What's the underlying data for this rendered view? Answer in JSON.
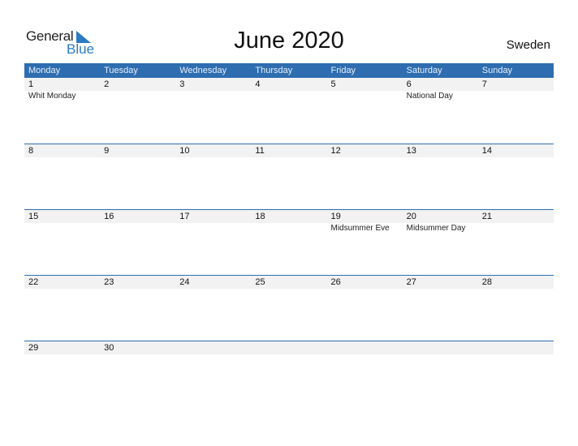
{
  "logo": {
    "general": "General",
    "blue": "Blue"
  },
  "title": "June 2020",
  "country": "Sweden",
  "colors": {
    "header": "#2e6db0",
    "date_strip": "#f2f2f2",
    "logo_blue": "#2a7ac4"
  },
  "weekdays": [
    "Monday",
    "Tuesday",
    "Wednesday",
    "Thursday",
    "Friday",
    "Saturday",
    "Sunday"
  ],
  "weeks": [
    [
      {
        "d": "1",
        "h": "Whit Monday"
      },
      {
        "d": "2",
        "h": ""
      },
      {
        "d": "3",
        "h": ""
      },
      {
        "d": "4",
        "h": ""
      },
      {
        "d": "5",
        "h": ""
      },
      {
        "d": "6",
        "h": "National Day"
      },
      {
        "d": "7",
        "h": ""
      }
    ],
    [
      {
        "d": "8",
        "h": ""
      },
      {
        "d": "9",
        "h": ""
      },
      {
        "d": "10",
        "h": ""
      },
      {
        "d": "11",
        "h": ""
      },
      {
        "d": "12",
        "h": ""
      },
      {
        "d": "13",
        "h": ""
      },
      {
        "d": "14",
        "h": ""
      }
    ],
    [
      {
        "d": "15",
        "h": ""
      },
      {
        "d": "16",
        "h": ""
      },
      {
        "d": "17",
        "h": ""
      },
      {
        "d": "18",
        "h": ""
      },
      {
        "d": "19",
        "h": "Midsummer Eve"
      },
      {
        "d": "20",
        "h": "Midsummer Day"
      },
      {
        "d": "21",
        "h": ""
      }
    ],
    [
      {
        "d": "22",
        "h": ""
      },
      {
        "d": "23",
        "h": ""
      },
      {
        "d": "24",
        "h": ""
      },
      {
        "d": "25",
        "h": ""
      },
      {
        "d": "26",
        "h": ""
      },
      {
        "d": "27",
        "h": ""
      },
      {
        "d": "28",
        "h": ""
      }
    ],
    [
      {
        "d": "29",
        "h": ""
      },
      {
        "d": "30",
        "h": ""
      },
      {
        "d": "",
        "h": ""
      },
      {
        "d": "",
        "h": ""
      },
      {
        "d": "",
        "h": ""
      },
      {
        "d": "",
        "h": ""
      },
      {
        "d": "",
        "h": ""
      }
    ]
  ]
}
